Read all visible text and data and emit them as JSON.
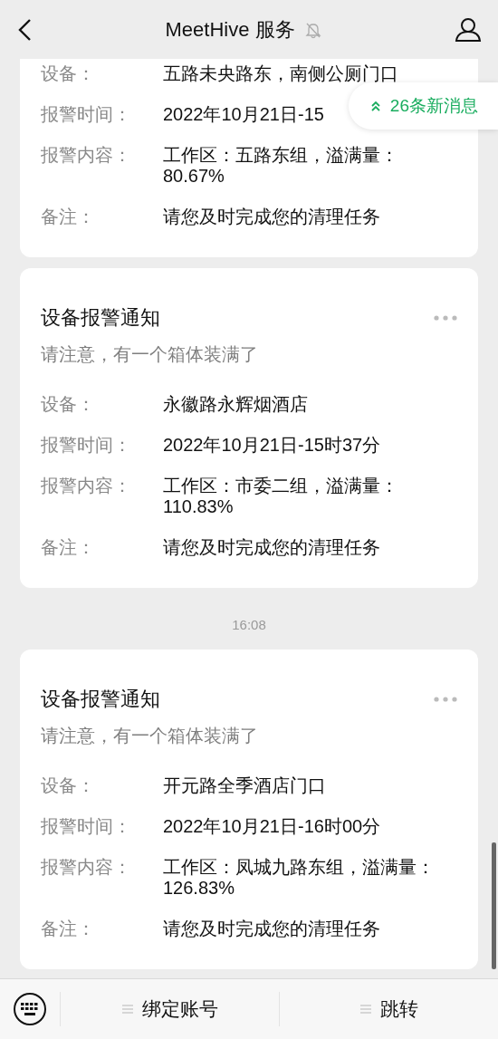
{
  "header": {
    "title": "MeetHive 服务",
    "muted": true
  },
  "new_messages_badge": "26条新消息",
  "messages": [
    {
      "kind": "card",
      "fields": [
        {
          "label": "设备：",
          "value": "五路未央路东，南侧公厕门口"
        },
        {
          "label": "报警时间：",
          "value": "2022年10月21日-15"
        },
        {
          "label": "报警内容：",
          "value": "工作区：五路东组，溢满量：80.67%"
        },
        {
          "label": "备注：",
          "value": "请您及时完成您的清理任务"
        }
      ]
    },
    {
      "kind": "card",
      "title": "设备报警通知",
      "subtitle": "请注意，有一个箱体装满了",
      "fields": [
        {
          "label": "设备：",
          "value": "永徽路永辉烟酒店"
        },
        {
          "label": "报警时间：",
          "value": "2022年10月21日-15时37分"
        },
        {
          "label": "报警内容：",
          "value": "工作区：市委二组，溢满量：110.83%"
        },
        {
          "label": "备注：",
          "value": "请您及时完成您的清理任务"
        }
      ]
    },
    {
      "kind": "time",
      "text": "16:08"
    },
    {
      "kind": "card",
      "title": "设备报警通知",
      "subtitle": "请注意，有一个箱体装满了",
      "fields": [
        {
          "label": "设备：",
          "value": "开元路全季酒店门口"
        },
        {
          "label": "报警时间：",
          "value": "2022年10月21日-16时00分"
        },
        {
          "label": "报警内容：",
          "value": "工作区：凤城九路东组，溢满量：126.83%"
        },
        {
          "label": "备注：",
          "value": "请您及时完成您的清理任务"
        }
      ]
    }
  ],
  "bottom_menu": [
    {
      "label": "绑定账号"
    },
    {
      "label": "跳转"
    }
  ]
}
